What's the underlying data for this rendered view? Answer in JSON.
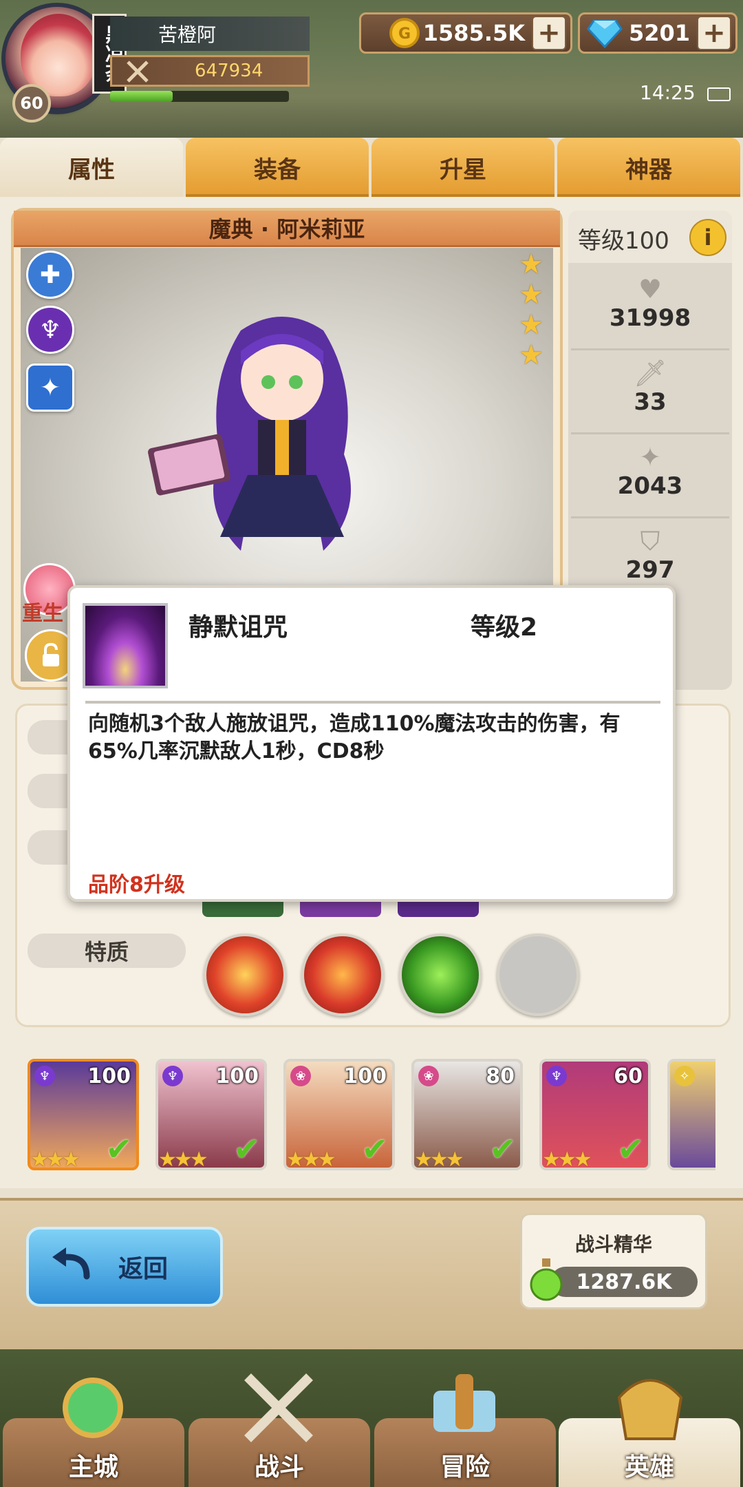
{
  "player": {
    "name": "苦橙阿",
    "level": "60",
    "guild_tag": "黑凉荼",
    "power": "647934",
    "exp_fraction": 0.35
  },
  "resources": {
    "gold": "1585.5K",
    "gems": "5201",
    "plus": "+"
  },
  "status": {
    "time": "14:25"
  },
  "tabs": [
    {
      "label": "属性"
    },
    {
      "label": "装备"
    },
    {
      "label": "升星"
    },
    {
      "label": "神器"
    }
  ],
  "hero": {
    "title": "魔典 · 阿米莉亚",
    "stars": 4,
    "level_label": "等级100",
    "info": "i",
    "rebirth_label": "重生",
    "stats": [
      {
        "icon": "heart-icon",
        "value": "31998"
      },
      {
        "icon": "sword-icon",
        "value": "33"
      },
      {
        "icon": "blade-icon",
        "value": "2043"
      },
      {
        "icon": "shield-icon",
        "value": "297"
      }
    ]
  },
  "panel": {
    "traits_label": "特质"
  },
  "tooltip": {
    "skill_name": "静默诅咒",
    "skill_level": "等级2",
    "description": "向随机3个敌人施放诅咒，造成110%魔法攻击的伤害，有65%几率沉默敌人1秒，CD8秒",
    "requirement": "品阶8升级"
  },
  "roster": [
    {
      "level": "100",
      "stars": "★★★",
      "class": "purple",
      "selected": true
    },
    {
      "level": "100",
      "stars": "★★★",
      "class": "purple",
      "selected": false
    },
    {
      "level": "100",
      "stars": "★★★",
      "class": "pink",
      "selected": false
    },
    {
      "level": "80",
      "stars": "★★★",
      "class": "pink",
      "selected": false
    },
    {
      "level": "60",
      "stars": "★★★",
      "class": "purple",
      "selected": false
    }
  ],
  "actions": {
    "back_label": "返回",
    "essence_title": "战斗精华",
    "essence_value": "1287.6K"
  },
  "nav": [
    {
      "label": "主城"
    },
    {
      "label": "战斗"
    },
    {
      "label": "冒险"
    },
    {
      "label": "英雄"
    }
  ],
  "colors": {
    "tab_active": "#f6efe0",
    "tab_inactive": "#f7c262",
    "requirement_red": "#d1321d",
    "star_gold": "#f6c338"
  }
}
